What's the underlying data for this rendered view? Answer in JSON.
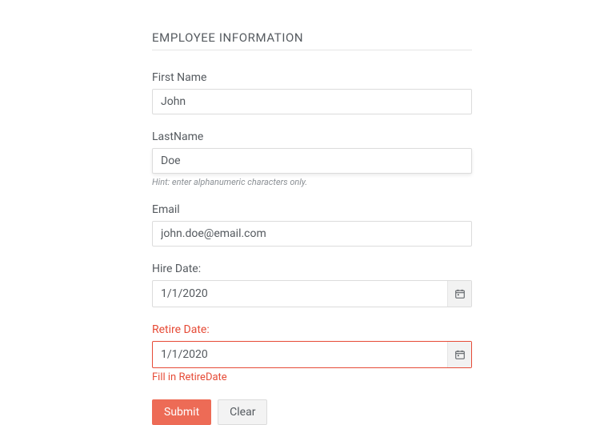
{
  "section_title": "EMPLOYEE INFORMATION",
  "fields": {
    "first_name": {
      "label": "First Name",
      "value": "John"
    },
    "last_name": {
      "label": "LastName",
      "value": "Doe",
      "hint": "Hint: enter alphanumeric characters only."
    },
    "email": {
      "label": "Email",
      "value": "john.doe@email.com"
    },
    "hire_date": {
      "label": "Hire Date:",
      "value": "1/1/2020"
    },
    "retire_date": {
      "label": "Retire Date:",
      "value": "1/1/2020",
      "error": "Fill in RetireDate"
    }
  },
  "buttons": {
    "submit": "Submit",
    "clear": "Clear"
  },
  "colors": {
    "accent": "#ed6b56",
    "error": "#e64b37"
  }
}
